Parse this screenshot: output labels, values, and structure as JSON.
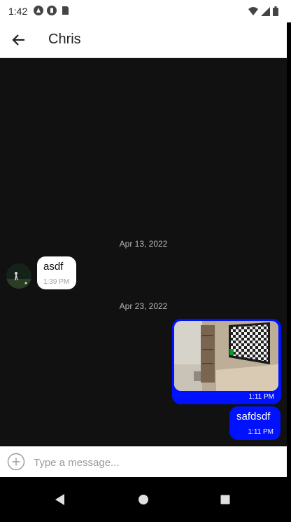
{
  "status_bar": {
    "time": "1:42"
  },
  "header": {
    "title": "Chris",
    "back_icon": "arrow-back-icon"
  },
  "chat": {
    "date_1": "Apr 13, 2022",
    "incoming": {
      "text": "asdf",
      "time": "1:39 PM"
    },
    "date_2": "Apr 23, 2022",
    "outgoing_image": {
      "time": "1:11 PM"
    },
    "outgoing_text": {
      "text": "safdsdf",
      "time": "1:11 PM"
    },
    "bubble_color": "#0011ff"
  },
  "composer": {
    "placeholder": "Type a message..."
  },
  "nav": [
    "back-icon",
    "home-icon",
    "recents-icon"
  ]
}
